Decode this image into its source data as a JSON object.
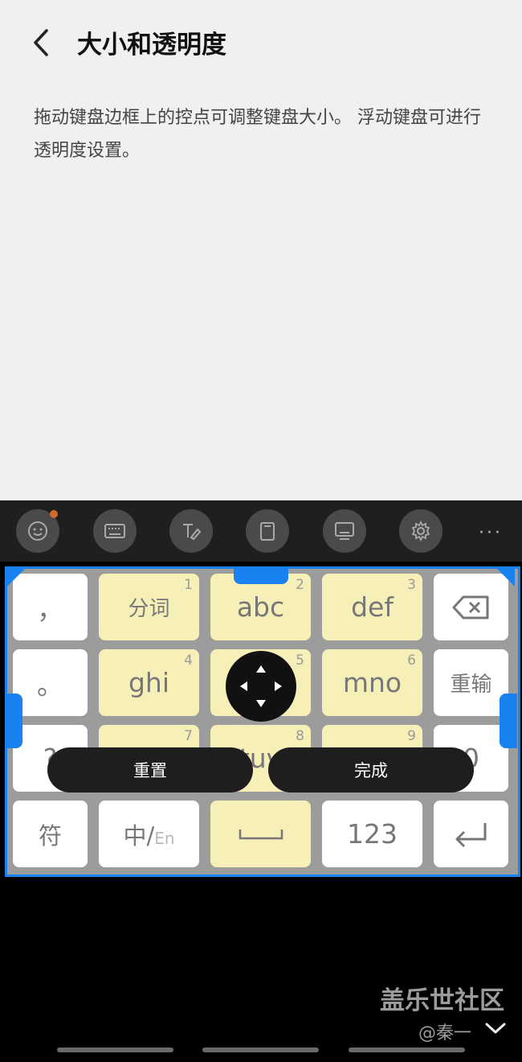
{
  "header": {
    "title": "大小和透明度",
    "back_icon": "chevron-left-icon"
  },
  "description": "拖动键盘边框上的控点可调整键盘大小。 浮动键盘可进行透明度设置。",
  "toolbar": {
    "icons": [
      "emoji-icon",
      "keyboard-icon",
      "handwriting-icon",
      "clipboard-icon",
      "keyboard-mode-icon",
      "settings-icon"
    ],
    "more": "···"
  },
  "keyboard": {
    "row1": {
      "comma": "，",
      "k1": {
        "label": "分词",
        "num": "1"
      },
      "k2": {
        "label": "abc",
        "num": "2"
      },
      "k3": {
        "label": "def",
        "num": "3"
      }
    },
    "row2": {
      "period": "。",
      "k4": {
        "label": "ghi",
        "num": "4"
      },
      "k5": {
        "num": "5"
      },
      "k6": {
        "label": "mno",
        "num": "6"
      },
      "reenter": "重输"
    },
    "row3": {
      "left": "?",
      "k7": {
        "num": "7"
      },
      "k8": {
        "label": "tuv",
        "num": "8"
      },
      "k9": {
        "num": "9"
      },
      "right": "0"
    },
    "row4": {
      "symbol": "符",
      "lang_zh": "中/",
      "lang_en": "En",
      "num_label": "123"
    },
    "reset_label": "重置",
    "done_label": "完成"
  },
  "watermark": {
    "line1": "盖乐世社区",
    "line2": "@秦一"
  },
  "colors": {
    "accent": "#1a82f0",
    "key_yellow": "#f7efb8",
    "key_white": "#ffffff"
  }
}
